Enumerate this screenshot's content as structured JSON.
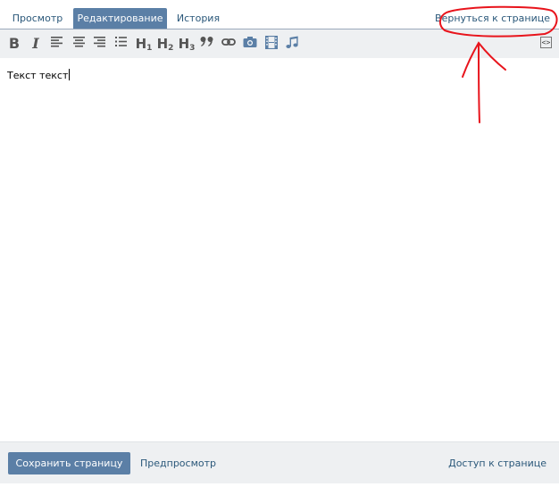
{
  "tabs": [
    {
      "label": "Просмотр",
      "active": false
    },
    {
      "label": "Редактирование",
      "active": true
    },
    {
      "label": "История",
      "active": false
    }
  ],
  "header": {
    "back_link": "Вернуться к странице"
  },
  "toolbar": {
    "bold": "B",
    "italic": "I",
    "h1": "H",
    "h1_sub": "1",
    "h2": "H",
    "h2_sub": "2",
    "h3": "H",
    "h3_sub": "3",
    "quote": "❞",
    "icons": [
      "bold-icon",
      "italic-icon",
      "align-left-icon",
      "align-center-icon",
      "align-right-icon",
      "bulleted-list-icon",
      "heading-1-icon",
      "heading-2-icon",
      "heading-3-icon",
      "quote-icon",
      "link-icon",
      "camera-icon",
      "film-icon",
      "music-note-icon",
      "source-code-icon"
    ],
    "source_label": "<>"
  },
  "editor": {
    "content": "Текст текст"
  },
  "footer": {
    "save_label": "Сохранить страницу",
    "preview_label": "Предпросмотр",
    "access_label": "Доступ к странице"
  },
  "colors": {
    "accent": "#5b7fa6",
    "link": "#2b587a",
    "toolbar_bg": "#eef0f2",
    "annotation": "#e8141c"
  }
}
